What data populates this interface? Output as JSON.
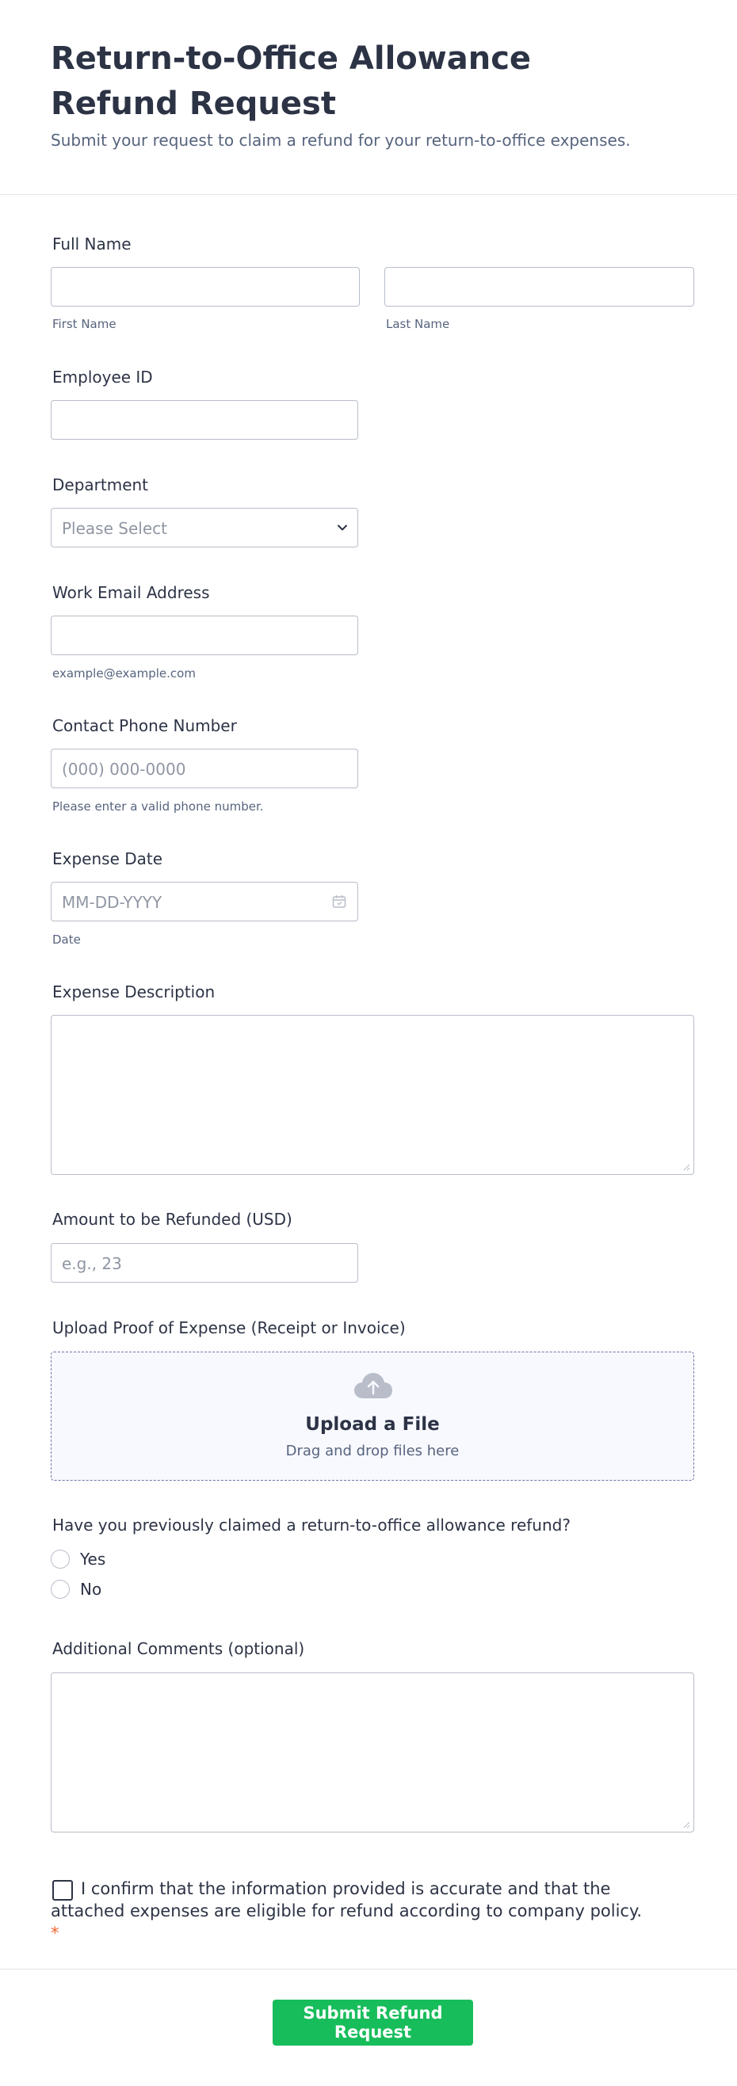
{
  "header": {
    "title": "Return-to-Office Allowance Refund Request",
    "subtitle": "Submit your request to claim a refund for your return-to-office expenses."
  },
  "full_name": {
    "label": "Full Name",
    "first_sublabel": "First Name",
    "last_sublabel": "Last Name"
  },
  "employee_id": {
    "label": "Employee ID"
  },
  "department": {
    "label": "Department",
    "selected": "Please Select"
  },
  "work_email": {
    "label": "Work Email Address",
    "sublabel": "example@example.com"
  },
  "phone": {
    "label": "Contact Phone Number",
    "placeholder": "(000) 000-0000",
    "sublabel": "Please enter a valid phone number."
  },
  "expense_date": {
    "label": "Expense Date",
    "placeholder": "MM-DD-YYYY",
    "sublabel": "Date"
  },
  "expense_description": {
    "label": "Expense Description"
  },
  "amount": {
    "label": "Amount to be Refunded (USD)",
    "placeholder": "e.g., 23"
  },
  "upload": {
    "label": "Upload Proof of Expense (Receipt or Invoice)",
    "title": "Upload a File",
    "subtitle": "Drag and drop files here",
    "icon": "cloud-upload-icon"
  },
  "previous_claim": {
    "label": "Have you previously claimed a return-to-office allowance refund?",
    "options": [
      "Yes",
      "No"
    ]
  },
  "comments": {
    "label": "Additional Comments (optional)"
  },
  "confirmation": {
    "text": "I confirm that the information provided is accurate and that the attached expenses are eligible for refund according to company policy.",
    "required_mark": "*"
  },
  "submit_label": "Submit Refund Request",
  "colors": {
    "text": "#2c3345",
    "muted": "#57647e",
    "border": "#b8bdc9",
    "submit": "#18bd5b",
    "required": "#f0652f"
  }
}
